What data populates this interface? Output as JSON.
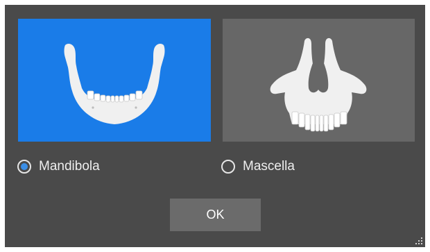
{
  "dialog": {
    "options": [
      {
        "id": "mandible",
        "label": "Mandibola",
        "selected": true,
        "image": "mandible-jaw-illustration"
      },
      {
        "id": "maxilla",
        "label": "Mascella",
        "selected": false,
        "image": "maxilla-skull-illustration"
      }
    ],
    "ok_label": "OK",
    "resize_icon": "resize-grip-icon"
  },
  "colors": {
    "dialog_bg": "#4a4a4a",
    "selected_card_bg": "#1a7ce8",
    "unselected_card_bg": "#676767",
    "radio_accent": "#3a8ee6",
    "button_bg": "#6b6b6b",
    "bone": "#f0f0f0"
  }
}
